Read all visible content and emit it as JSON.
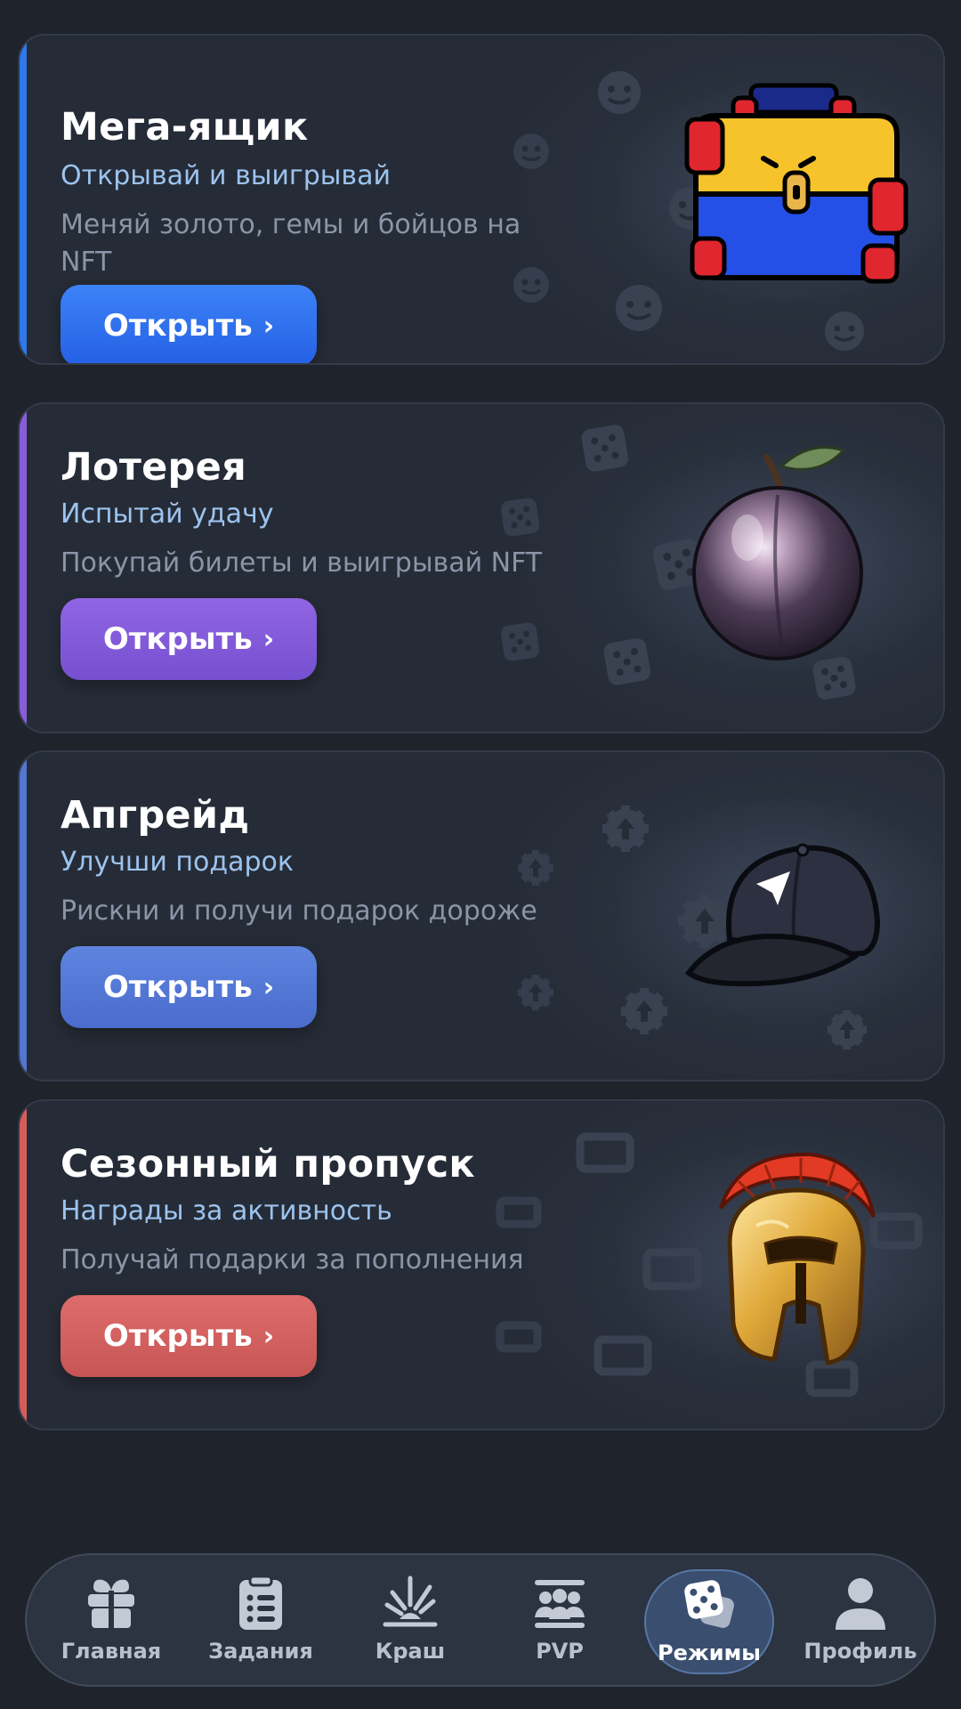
{
  "cards": [
    {
      "title": "Мега-ящик",
      "subtitle": "Открывай и выигрывай",
      "description": "Меняй золото, гемы и бойцов на NFT",
      "button": "Открыть",
      "button_color": "#2d6ff0",
      "accent_color": "#2e78ea",
      "image": "mega-box-image",
      "pattern_icon": "smile-icon"
    },
    {
      "title": "Лотерея",
      "subtitle": "Испытай удачу",
      "description": "Покупай билеты и выигрывай NFT",
      "button": "Открыть",
      "button_color": "#8358d8",
      "accent_color": "#8a5cd8",
      "image": "plum-image",
      "pattern_icon": "dice-icon"
    },
    {
      "title": "Апгрейд",
      "subtitle": "Улучши подарок",
      "description": "Рискни и получи подарок дороже",
      "button": "Открыть",
      "button_color": "#5276d6",
      "accent_color": "#5277d0",
      "image": "cap-image",
      "pattern_icon": "upgrade-gear-icon"
    },
    {
      "title": "Сезонный пропуск",
      "subtitle": "Награды за активность",
      "description": "Получай подарки за пополнения",
      "button": "Открыть",
      "button_color": "#d0605f",
      "accent_color": "#d65c5a",
      "image": "helmet-image",
      "pattern_icon": "ticket-icon"
    }
  ],
  "chevron": "›",
  "nav": [
    {
      "label": "Главная",
      "icon": "gift-icon",
      "active": false
    },
    {
      "label": "Задания",
      "icon": "clipboard-icon",
      "active": false
    },
    {
      "label": "Краш",
      "icon": "crash-icon",
      "active": false
    },
    {
      "label": "PVP",
      "icon": "pvp-icon",
      "active": false
    },
    {
      "label": "Режимы",
      "icon": "dice-icon",
      "active": true
    },
    {
      "label": "Профиль",
      "icon": "profile-icon",
      "active": false
    }
  ]
}
